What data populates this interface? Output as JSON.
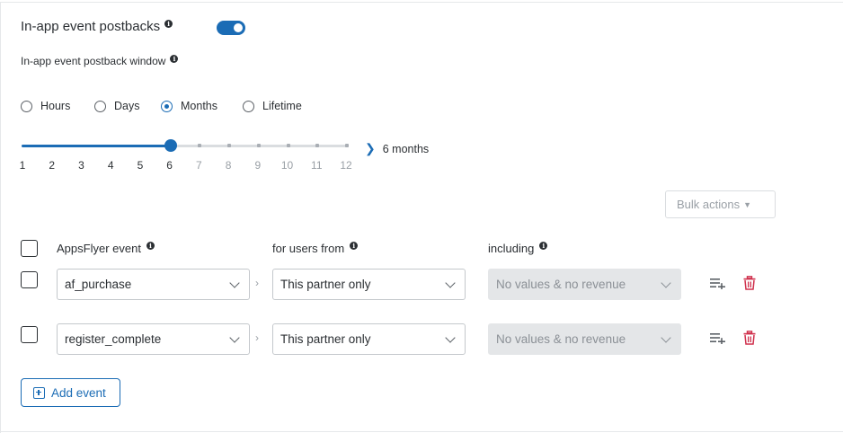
{
  "section": {
    "title": "In-app event postbacks",
    "toggle_on": true,
    "window_label": "In-app event postback window"
  },
  "window_options": [
    {
      "label": "Hours",
      "selected": false
    },
    {
      "label": "Days",
      "selected": false
    },
    {
      "label": "Months",
      "selected": true
    },
    {
      "label": "Lifetime",
      "selected": false
    }
  ],
  "slider": {
    "labels": [
      "1",
      "2",
      "3",
      "4",
      "5",
      "6",
      "7",
      "8",
      "9",
      "10",
      "11",
      "12"
    ],
    "value": 6,
    "value_text": "6 months"
  },
  "bulk_actions_label": "Bulk actions",
  "columns": {
    "event": "AppsFlyer event",
    "users_from": "for users from",
    "including": "including"
  },
  "rows": [
    {
      "event": "af_purchase",
      "users_from": "This partner only",
      "including": "No values & no revenue"
    },
    {
      "event": "register_complete",
      "users_from": "This partner only",
      "including": "No values & no revenue"
    }
  ],
  "add_event_label": "Add event",
  "colors": {
    "accent": "#1b6cb5",
    "danger": "#d0314d"
  }
}
